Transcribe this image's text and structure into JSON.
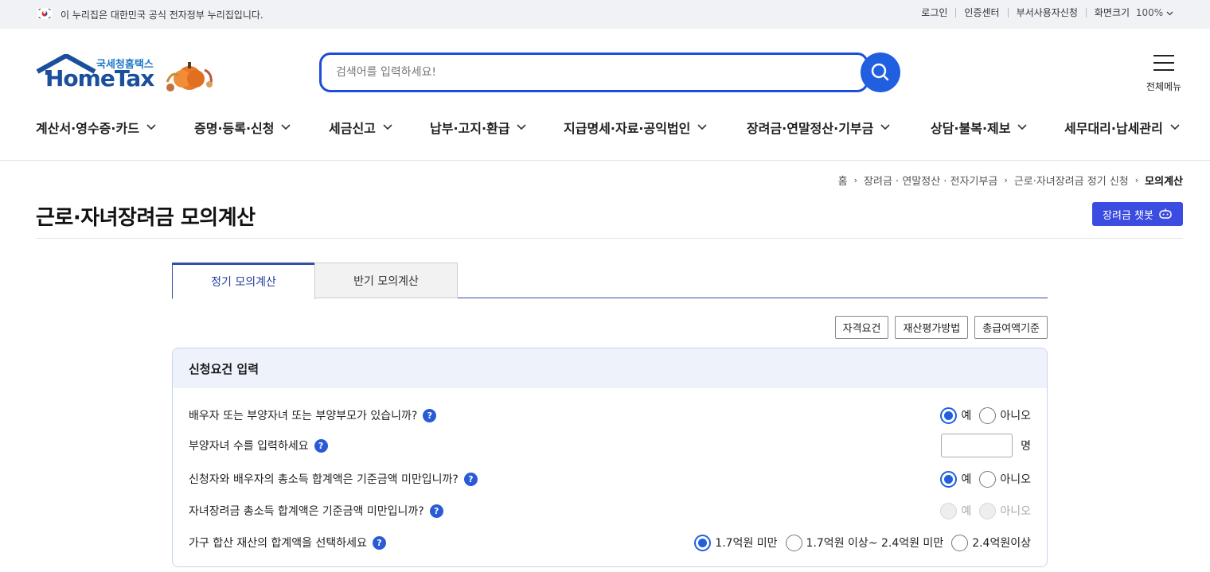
{
  "topbar": {
    "gov_notice": "이 누리집은 대한민국 공식 전자정부 누리집입니다.",
    "links": [
      "로그인",
      "인증센터",
      "부서사용자신청",
      "화면크기"
    ],
    "zoom": "100%"
  },
  "logo": {
    "small": "국세청홈택스",
    "big": "HomeTax"
  },
  "search": {
    "placeholder": "검색어를 입력하세요!"
  },
  "all_menu": {
    "label": "전체메뉴"
  },
  "gnb": [
    "계산서·영수증·카드",
    "증명·등록·신청",
    "세금신고",
    "납부·고지·환급",
    "지급명세·자료·공익법인",
    "장려금·연말정산·기부금",
    "상담·불복·제보",
    "세무대리·납세관리"
  ],
  "breadcrumb": {
    "items": [
      "홈",
      "장려금 · 연말정산 · 전자기부금",
      "근로·자녀장려금 정기 신청"
    ],
    "current": "모의계산"
  },
  "page": {
    "title": "근로·자녀장려금 모의계산",
    "chatbot": "장려금 챗봇"
  },
  "tabs": {
    "active": "정기 모의계산",
    "inactive": "반기 모의계산"
  },
  "buttons": [
    "자격요건",
    "재산평가방법",
    "총급여액기준"
  ],
  "panel": {
    "title": "신청요건 입력",
    "rows": [
      {
        "question": "배우자 또는 부양자녀 또는 부양부모가 있습니까?",
        "options": [
          "예",
          "아니오"
        ],
        "selected": "예"
      },
      {
        "question": "부양자녀 수를 입력하세요",
        "value": "",
        "unit": "명"
      },
      {
        "question": "신청자와 배우자의 총소득 합계액은 기준금액 미만입니까?",
        "options": [
          "예",
          "아니오"
        ],
        "selected": "예"
      },
      {
        "question": "자녀장려금 총소득 합계액은 기준금액 미만입니까?",
        "options": [
          "예",
          "아니오"
        ],
        "selected": null,
        "disabled": true
      },
      {
        "question": "가구 합산 재산의 합계액을 선택하세요",
        "options": [
          "1.7억원 미만",
          "1.7억원 이상~ 2.4억원 미만",
          "2.4억원이상"
        ],
        "selected": "1.7억원 미만"
      }
    ]
  },
  "colors": {
    "primary": "#1f5fe0",
    "chatbot": "#3b4de0",
    "logo": "#1b4f9c",
    "tab_border": "#2f4fa8"
  }
}
